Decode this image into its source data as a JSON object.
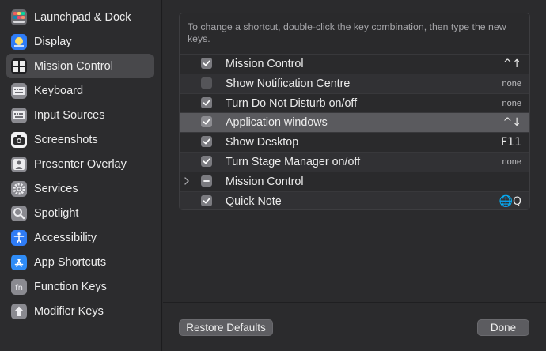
{
  "sidebar": {
    "items": [
      {
        "label": "Launchpad & Dock",
        "icon": "launchpad-dock-icon",
        "selected": false
      },
      {
        "label": "Display",
        "icon": "display-icon",
        "selected": false
      },
      {
        "label": "Mission Control",
        "icon": "mission-control-icon",
        "selected": true
      },
      {
        "label": "Keyboard",
        "icon": "keyboard-icon",
        "selected": false
      },
      {
        "label": "Input Sources",
        "icon": "input-sources-icon",
        "selected": false
      },
      {
        "label": "Screenshots",
        "icon": "camera-icon",
        "selected": false
      },
      {
        "label": "Presenter Overlay",
        "icon": "presenter-overlay-icon",
        "selected": false
      },
      {
        "label": "Services",
        "icon": "gear-icon",
        "selected": false
      },
      {
        "label": "Spotlight",
        "icon": "magnifier-icon",
        "selected": false
      },
      {
        "label": "Accessibility",
        "icon": "accessibility-icon",
        "selected": false
      },
      {
        "label": "App Shortcuts",
        "icon": "app-store-icon",
        "selected": false
      },
      {
        "label": "Function Keys",
        "icon": "fn-key-icon",
        "selected": false
      },
      {
        "label": "Modifier Keys",
        "icon": "arrow-up-icon",
        "selected": false
      }
    ]
  },
  "main": {
    "hint": "To change a shortcut, double-click the key combination, then type the new keys.",
    "rows": [
      {
        "label": "Mission Control",
        "shortcut": "^↑",
        "state": "checked",
        "expandable": false
      },
      {
        "label": "Show Notification Centre",
        "shortcut": "none",
        "state": "unchecked",
        "expandable": false
      },
      {
        "label": "Turn Do Not Disturb on/off",
        "shortcut": "none",
        "state": "checked",
        "expandable": false
      },
      {
        "label": "Application windows",
        "shortcut": "^↓",
        "state": "checked",
        "expandable": false,
        "highlight": true
      },
      {
        "label": "Show Desktop",
        "shortcut": "F11",
        "state": "checked",
        "expandable": false
      },
      {
        "label": "Turn Stage Manager on/off",
        "shortcut": "none",
        "state": "checked",
        "expandable": false
      },
      {
        "label": "Mission Control",
        "shortcut": "",
        "state": "mixed",
        "expandable": true
      },
      {
        "label": "Quick Note",
        "shortcut": "🌐Q",
        "state": "checked",
        "expandable": false
      }
    ]
  },
  "footer": {
    "restore_label": "Restore Defaults",
    "done_label": "Done"
  },
  "colors": {
    "background": "#2a2a2c",
    "sidebar_selected": "#48484b",
    "row_highlight": "#5a5a5e",
    "checkbox": "#7b7b80"
  }
}
